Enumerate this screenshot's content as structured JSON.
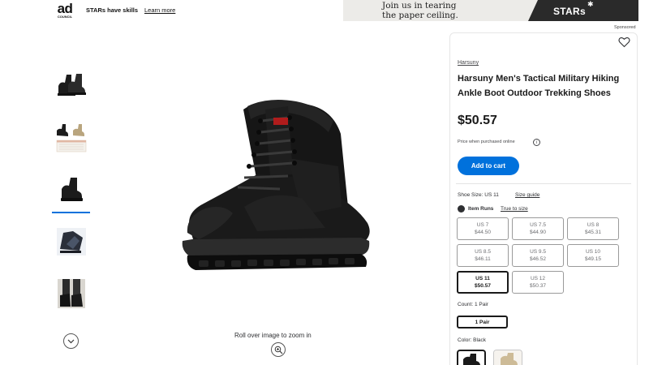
{
  "ad": {
    "logo_big": "ad",
    "logo_small": "COUNCIL",
    "tagline": "STARs have skills",
    "learn_more": "Learn more",
    "banner_line1": "Join us in tearing",
    "banner_line2": "the paper ceiling.",
    "banner_brand": "STARs",
    "banner_spark": "✱",
    "sponsored": "Sponsored"
  },
  "gallery": {
    "selected_thumbnail_index": 2,
    "thumbnail_icons": [
      "boot-pair-thumbnail",
      "color-variants-thumbnail",
      "single-boot-thumbnail",
      "boot-sole-thumbnail",
      "boot-worn-thumbnail"
    ],
    "zoom_hint": "Roll over image to zoom in"
  },
  "product": {
    "brand": "Harsuny",
    "title": "Harsuny Men's Tactical Military Hiking Ankle Boot Outdoor Trekking Shoes",
    "price": "$50.57",
    "price_note": "Price when purchased online",
    "info_glyph": "i",
    "add_to_cart": "Add to cart",
    "accent_color": "#0071dc"
  },
  "size": {
    "label": "Shoe Size:",
    "selected": "US 11",
    "guide": "Size guide",
    "runs_label": "Item Runs",
    "runs_value": "True to size",
    "options": [
      {
        "size": "US 7",
        "price": "$44.50"
      },
      {
        "size": "US 7.5",
        "price": "$44.90"
      },
      {
        "size": "US 8",
        "price": "$45.31"
      },
      {
        "size": "US 8.5",
        "price": "$46.11"
      },
      {
        "size": "US 9.5",
        "price": "$46.52"
      },
      {
        "size": "US 10",
        "price": "$49.15"
      },
      {
        "size": "US 11",
        "price": "$50.57"
      },
      {
        "size": "US 12",
        "price": "$50.37"
      }
    ]
  },
  "count": {
    "label": "Count:",
    "selected": "1 Pair",
    "option": "1 Pair"
  },
  "color": {
    "label": "Color:",
    "selected": "Black",
    "swatches": [
      "#1a1a1a",
      "#cdbb97"
    ]
  }
}
